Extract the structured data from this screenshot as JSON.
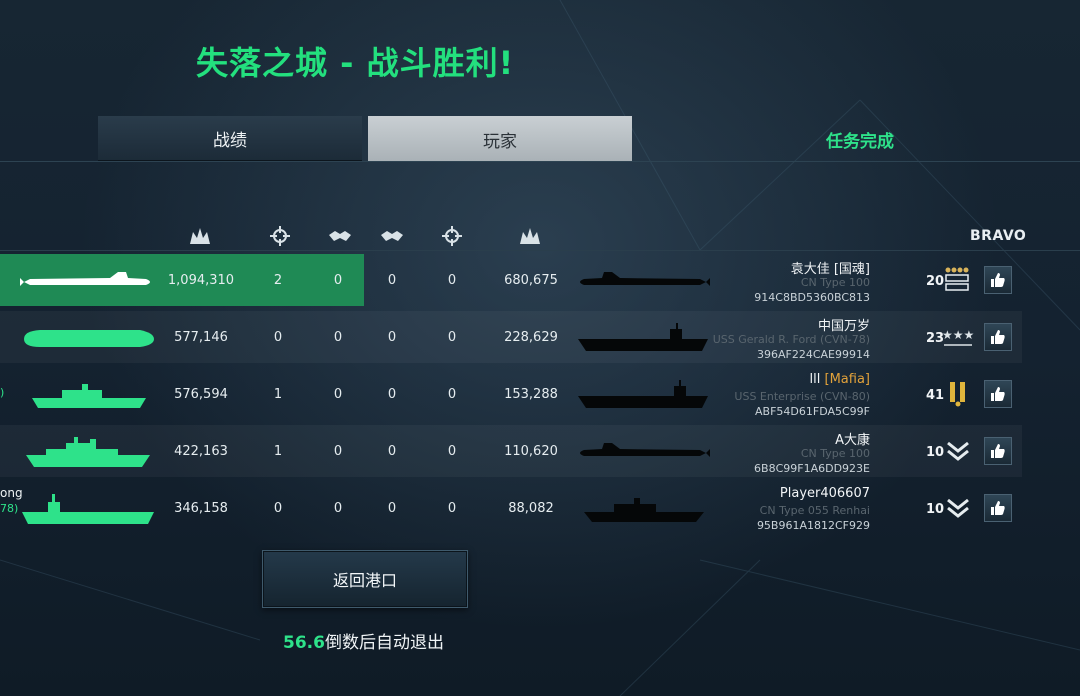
{
  "title": "失落之城 - 战斗胜利!",
  "tabs": {
    "stats": "战绩",
    "players": "玩家",
    "mission": "任务完成"
  },
  "columns": {
    "icons": [
      "damage-icon",
      "crosshair-icon",
      "assist-icon",
      "assist-icon",
      "crosshair-icon",
      "damage-icon"
    ],
    "bravo": "BRAVO"
  },
  "left_team": [
    {
      "ship": "submarine",
      "damage": "1,094,310",
      "kills": "2",
      "assists": "0",
      "own": true
    },
    {
      "ship": "submarine-bulky",
      "damage": "577,146",
      "kills": "0",
      "assists": "0"
    },
    {
      "ship": "destroyer",
      "damage": "576,594",
      "kills": "1",
      "assists": "0",
      "name_fragment": ")"
    },
    {
      "ship": "cruiser",
      "damage": "422,163",
      "kills": "1",
      "assists": "0"
    },
    {
      "ship": "carrier",
      "damage": "346,158",
      "kills": "0",
      "assists": "0",
      "name_fragment": "ong",
      "ship_fragment": "78)"
    }
  ],
  "right_team": [
    {
      "assists": "0",
      "kills": "0",
      "damage": "680,675",
      "ship": "submarine",
      "name": "袁大佳 ",
      "clan": "[国魂]",
      "clan_color": "#f2f5f7",
      "ship_name": "CN Type 100",
      "player_id": "914C8BD5360BC813",
      "rank": "20",
      "rank_badge": "chevron-stars-icon"
    },
    {
      "assists": "0",
      "kills": "0",
      "damage": "228,629",
      "ship": "carrier",
      "name": "中国万岁",
      "clan": "",
      "clan_color": "#f2f5f7",
      "ship_name": "USS Gerald R. Ford (CVN-78)",
      "player_id": "396AF224CAE99914",
      "rank": "23",
      "rank_badge": "three-stars-icon"
    },
    {
      "assists": "0",
      "kills": "0",
      "damage": "153,288",
      "ship": "carrier",
      "name": "lll ",
      "clan": "[Mafia]",
      "clan_color": "#e2a23a",
      "ship_name": "USS Enterprise (CVN-80)",
      "player_id": "ABF54D61FDA5C99F",
      "rank": "41",
      "rank_badge": "gold-bars-icon"
    },
    {
      "assists": "0",
      "kills": "0",
      "damage": "110,620",
      "ship": "submarine",
      "name": "A大康",
      "clan": "",
      "clan_color": "#f2f5f7",
      "ship_name": "CN Type 100",
      "player_id": "6B8C99F1A6DD923E",
      "rank": "10",
      "rank_badge": "double-chevron-icon"
    },
    {
      "assists": "0",
      "kills": "0",
      "damage": "88,082",
      "ship": "destroyer",
      "name": "Player406607",
      "clan": "",
      "clan_color": "#f2f5f7",
      "ship_name": "CN Type 055 Renhai",
      "player_id": "95B961A1812CF929",
      "rank": "10",
      "rank_badge": "double-chevron-icon"
    }
  ],
  "return_button": "返回港口",
  "countdown": {
    "seconds": "56.6",
    "text": "倒数后自动退出"
  },
  "colors": {
    "accent_green": "#2ee28a",
    "own_row": "#1f8a55",
    "clan_orange": "#e2a23a"
  }
}
